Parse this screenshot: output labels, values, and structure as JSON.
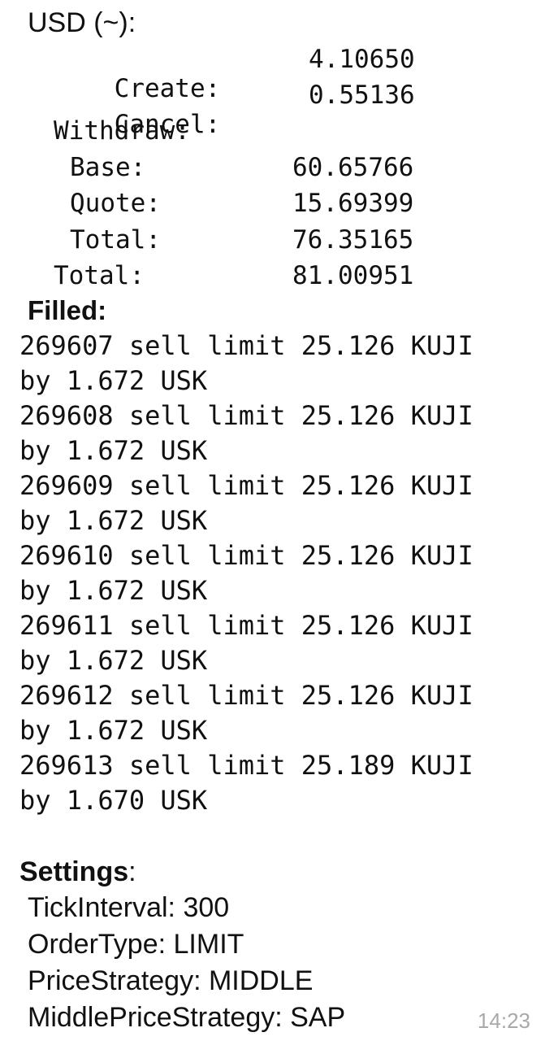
{
  "message": {
    "usd_section": {
      "title": "USD (~)",
      "colon": ":",
      "create_label": "Create:",
      "create_value": "4.10650",
      "cancel_label": "Cancel:",
      "cancel_value": "0.55136",
      "withdraw_label": "Withdraw:",
      "base_label": "Base:",
      "base_value": "60.65766",
      "quote_label": "Quote:",
      "quote_value": "15.69399",
      "withdraw_total_label": "Total:",
      "withdraw_total_value": "76.35165",
      "total_label": "Total:",
      "total_value": "81.00951"
    },
    "filled": {
      "title": "Filled:",
      "lines": [
        "269607 sell limit 25.126 KUJI",
        "by 1.672 USK",
        "269608 sell limit 25.126 KUJI",
        "by 1.672 USK",
        "269609 sell limit 25.126 KUJI",
        "by 1.672 USK",
        "269610 sell limit 25.126 KUJI",
        "by 1.672 USK",
        "269611 sell limit 25.126 KUJI",
        "by 1.672 USK",
        "269612 sell limit 25.126 KUJI",
        "by 1.672 USK",
        "269613 sell limit 25.189 KUJI",
        "by 1.670 USK"
      ]
    },
    "settings": {
      "title": "Settings",
      "colon": ":",
      "items": [
        "TickInterval: 300",
        "OrderType: LIMIT",
        "PriceStrategy: MIDDLE",
        "MiddlePriceStrategy: SAP"
      ]
    },
    "timestamp": "14:23"
  }
}
